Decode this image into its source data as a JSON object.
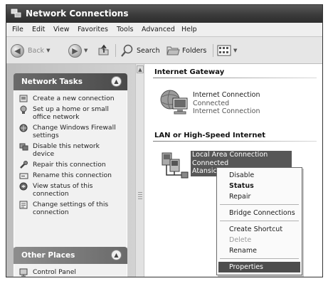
{
  "window": {
    "title": "Network Connections"
  },
  "menu": [
    "File",
    "Edit",
    "View",
    "Favorites",
    "Tools",
    "Advanced",
    "Help"
  ],
  "toolbar": {
    "back_label": "Back",
    "search_label": "Search",
    "folders_label": "Folders"
  },
  "network_tasks": {
    "header": "Network Tasks",
    "items": [
      {
        "label": "Create a new connection",
        "icon": "new-connection-icon"
      },
      {
        "label": "Set up a home or small office network",
        "icon": "home-network-icon"
      },
      {
        "label": "Change Windows Firewall settings",
        "icon": "firewall-icon"
      },
      {
        "label": "Disable this network device",
        "icon": "disable-device-icon"
      },
      {
        "label": "Repair this connection",
        "icon": "repair-icon"
      },
      {
        "label": "Rename this connection",
        "icon": "rename-icon"
      },
      {
        "label": "View status of this connection",
        "icon": "status-icon"
      },
      {
        "label": "Change settings of this connection",
        "icon": "settings-icon"
      }
    ]
  },
  "other_places": {
    "header": "Other Places",
    "items": [
      {
        "label": "Control Panel",
        "icon": "control-panel-icon"
      }
    ]
  },
  "groups": {
    "internet_gateway": {
      "header": "Internet Gateway",
      "name": "Internet Connection",
      "status": "Connected",
      "type": "Internet Connection"
    },
    "lan": {
      "header": "LAN or High-Speed Internet",
      "name": "Local Area Connection",
      "status": "Connected",
      "device": "Atansic L"
    }
  },
  "context_menu": {
    "items": [
      {
        "label": "Disable",
        "state": "normal"
      },
      {
        "label": "Status",
        "state": "bold"
      },
      {
        "label": "Repair",
        "state": "normal"
      },
      {
        "label": "Bridge Connections",
        "state": "normal"
      },
      {
        "label": "Create Shortcut",
        "state": "normal"
      },
      {
        "label": "Delete",
        "state": "disabled"
      },
      {
        "label": "Rename",
        "state": "normal"
      },
      {
        "label": "Properties",
        "state": "highlighted"
      }
    ]
  }
}
